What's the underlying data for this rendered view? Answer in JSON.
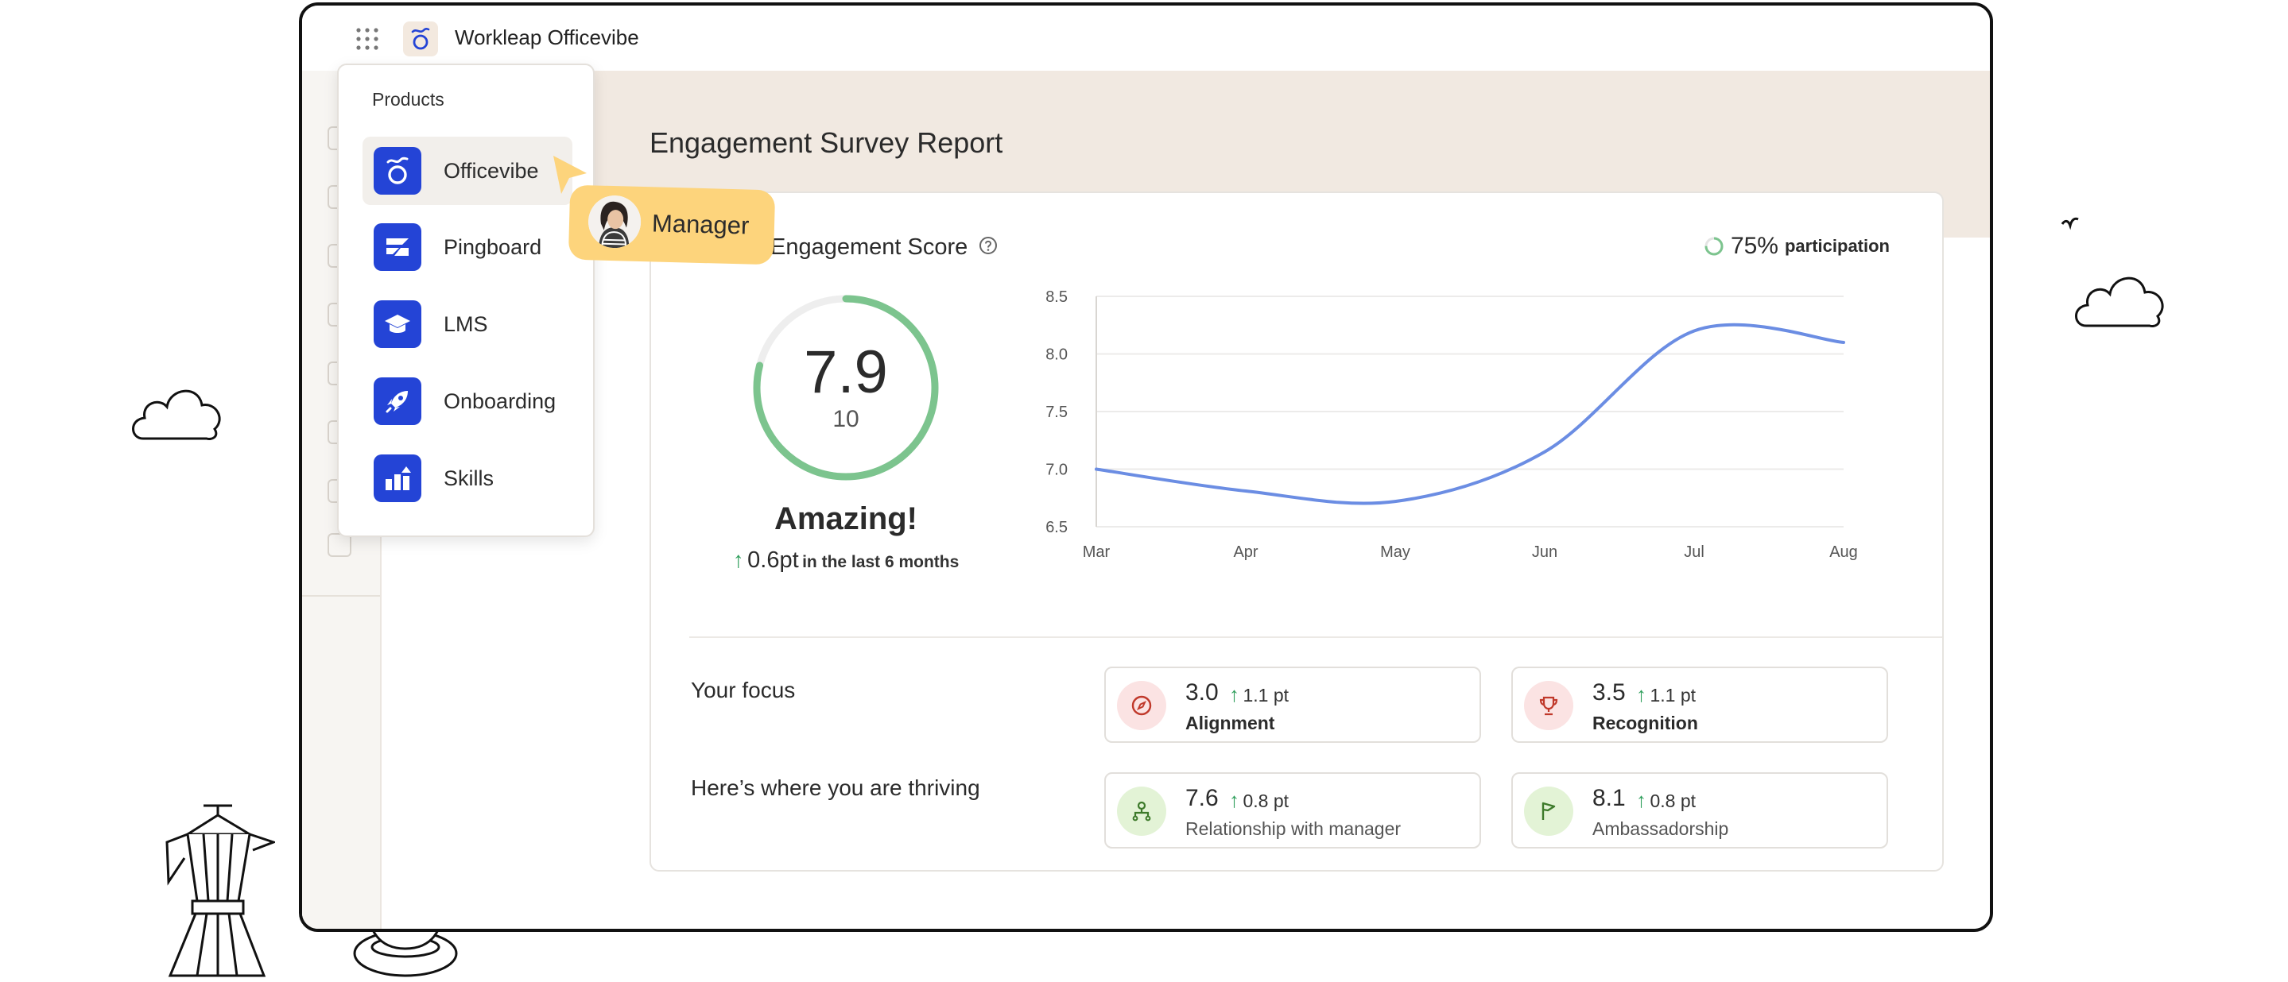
{
  "app": {
    "brand_name": "Workleap Officevibe"
  },
  "products_menu": {
    "heading": "Products",
    "items": [
      {
        "label": "Officevibe",
        "icon": "officevibe-logo-icon",
        "active": true
      },
      {
        "label": "Pingboard",
        "icon": "pingboard-logo-icon",
        "active": false
      },
      {
        "label": "LMS",
        "icon": "graduation-cap-icon",
        "active": false
      },
      {
        "label": "Onboarding",
        "icon": "rocket-icon",
        "active": false
      },
      {
        "label": "Skills",
        "icon": "bar-chart-arrow-icon",
        "active": false
      }
    ]
  },
  "manager_tag": {
    "label": "Manager"
  },
  "report": {
    "title": "Engagement Survey Report",
    "card_title": "Engagement Score",
    "participation": {
      "percent": "75%",
      "label": "participation",
      "fraction": 0.75
    },
    "score": {
      "value": "7.9",
      "max": "10",
      "fraction": 0.79,
      "label": "Amazing!",
      "change_value": "0.6pt",
      "change_period": "in the last 6 months"
    },
    "focus_label": "Your focus",
    "thriving_label": "Here’s where you are thriving",
    "focus": [
      {
        "score": "3.0",
        "delta": "1.1 pt",
        "name": "Alignment",
        "icon": "compass-icon",
        "icon_bg": "#fbe3e3",
        "icon_color": "#c0392b"
      },
      {
        "score": "3.5",
        "delta": "1.1 pt",
        "name": "Recognition",
        "icon": "trophy-icon",
        "icon_bg": "#fbe3e3",
        "icon_color": "#c0392b"
      }
    ],
    "thriving": [
      {
        "score": "7.6",
        "delta": "0.8 pt",
        "name": "Relationship with manager",
        "icon": "people-hierarchy-icon",
        "icon_bg": "#e3f3d6",
        "icon_color": "#3d7a2a"
      },
      {
        "score": "8.1",
        "delta": "0.8 pt",
        "name": "Ambassadorship",
        "icon": "flag-icon",
        "icon_bg": "#e3f3d6",
        "icon_color": "#3d7a2a"
      }
    ]
  },
  "chart_data": {
    "type": "line",
    "categories": [
      "Mar",
      "Apr",
      "May",
      "Jun",
      "Jul",
      "Aug"
    ],
    "y_ticks": [
      "8.5",
      "8.0",
      "7.5",
      "7.0",
      "6.5"
    ],
    "ylim": [
      6.5,
      8.5
    ],
    "series": [
      {
        "values": [
          7.0,
          6.81,
          6.72,
          7.15,
          8.2,
          8.1
        ],
        "color": "#6b8de3"
      }
    ],
    "grid": true
  },
  "colors": {
    "accent_blue": "#2444d6",
    "score_ring": "#7cc48e",
    "positive_arrow": "#2e9e5b",
    "banner": "#f1e9e1",
    "manager_tag": "#fdd47c"
  }
}
